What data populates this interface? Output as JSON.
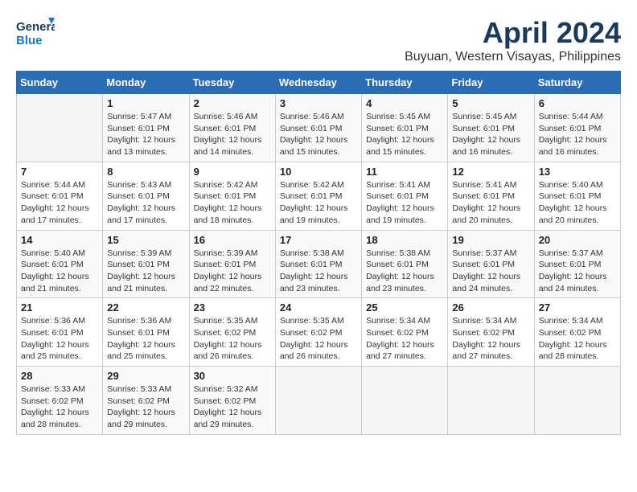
{
  "header": {
    "logo_general": "General",
    "logo_blue": "Blue",
    "month_title": "April 2024",
    "location": "Buyuan, Western Visayas, Philippines"
  },
  "weekdays": [
    "Sunday",
    "Monday",
    "Tuesday",
    "Wednesday",
    "Thursday",
    "Friday",
    "Saturday"
  ],
  "weeks": [
    [
      {
        "day": "",
        "info": ""
      },
      {
        "day": "1",
        "info": "Sunrise: 5:47 AM\nSunset: 6:01 PM\nDaylight: 12 hours\nand 13 minutes."
      },
      {
        "day": "2",
        "info": "Sunrise: 5:46 AM\nSunset: 6:01 PM\nDaylight: 12 hours\nand 14 minutes."
      },
      {
        "day": "3",
        "info": "Sunrise: 5:46 AM\nSunset: 6:01 PM\nDaylight: 12 hours\nand 15 minutes."
      },
      {
        "day": "4",
        "info": "Sunrise: 5:45 AM\nSunset: 6:01 PM\nDaylight: 12 hours\nand 15 minutes."
      },
      {
        "day": "5",
        "info": "Sunrise: 5:45 AM\nSunset: 6:01 PM\nDaylight: 12 hours\nand 16 minutes."
      },
      {
        "day": "6",
        "info": "Sunrise: 5:44 AM\nSunset: 6:01 PM\nDaylight: 12 hours\nand 16 minutes."
      }
    ],
    [
      {
        "day": "7",
        "info": "Sunrise: 5:44 AM\nSunset: 6:01 PM\nDaylight: 12 hours\nand 17 minutes."
      },
      {
        "day": "8",
        "info": "Sunrise: 5:43 AM\nSunset: 6:01 PM\nDaylight: 12 hours\nand 17 minutes."
      },
      {
        "day": "9",
        "info": "Sunrise: 5:42 AM\nSunset: 6:01 PM\nDaylight: 12 hours\nand 18 minutes."
      },
      {
        "day": "10",
        "info": "Sunrise: 5:42 AM\nSunset: 6:01 PM\nDaylight: 12 hours\nand 19 minutes."
      },
      {
        "day": "11",
        "info": "Sunrise: 5:41 AM\nSunset: 6:01 PM\nDaylight: 12 hours\nand 19 minutes."
      },
      {
        "day": "12",
        "info": "Sunrise: 5:41 AM\nSunset: 6:01 PM\nDaylight: 12 hours\nand 20 minutes."
      },
      {
        "day": "13",
        "info": "Sunrise: 5:40 AM\nSunset: 6:01 PM\nDaylight: 12 hours\nand 20 minutes."
      }
    ],
    [
      {
        "day": "14",
        "info": "Sunrise: 5:40 AM\nSunset: 6:01 PM\nDaylight: 12 hours\nand 21 minutes."
      },
      {
        "day": "15",
        "info": "Sunrise: 5:39 AM\nSunset: 6:01 PM\nDaylight: 12 hours\nand 21 minutes."
      },
      {
        "day": "16",
        "info": "Sunrise: 5:39 AM\nSunset: 6:01 PM\nDaylight: 12 hours\nand 22 minutes."
      },
      {
        "day": "17",
        "info": "Sunrise: 5:38 AM\nSunset: 6:01 PM\nDaylight: 12 hours\nand 23 minutes."
      },
      {
        "day": "18",
        "info": "Sunrise: 5:38 AM\nSunset: 6:01 PM\nDaylight: 12 hours\nand 23 minutes."
      },
      {
        "day": "19",
        "info": "Sunrise: 5:37 AM\nSunset: 6:01 PM\nDaylight: 12 hours\nand 24 minutes."
      },
      {
        "day": "20",
        "info": "Sunrise: 5:37 AM\nSunset: 6:01 PM\nDaylight: 12 hours\nand 24 minutes."
      }
    ],
    [
      {
        "day": "21",
        "info": "Sunrise: 5:36 AM\nSunset: 6:01 PM\nDaylight: 12 hours\nand 25 minutes."
      },
      {
        "day": "22",
        "info": "Sunrise: 5:36 AM\nSunset: 6:01 PM\nDaylight: 12 hours\nand 25 minutes."
      },
      {
        "day": "23",
        "info": "Sunrise: 5:35 AM\nSunset: 6:02 PM\nDaylight: 12 hours\nand 26 minutes."
      },
      {
        "day": "24",
        "info": "Sunrise: 5:35 AM\nSunset: 6:02 PM\nDaylight: 12 hours\nand 26 minutes."
      },
      {
        "day": "25",
        "info": "Sunrise: 5:34 AM\nSunset: 6:02 PM\nDaylight: 12 hours\nand 27 minutes."
      },
      {
        "day": "26",
        "info": "Sunrise: 5:34 AM\nSunset: 6:02 PM\nDaylight: 12 hours\nand 27 minutes."
      },
      {
        "day": "27",
        "info": "Sunrise: 5:34 AM\nSunset: 6:02 PM\nDaylight: 12 hours\nand 28 minutes."
      }
    ],
    [
      {
        "day": "28",
        "info": "Sunrise: 5:33 AM\nSunset: 6:02 PM\nDaylight: 12 hours\nand 28 minutes."
      },
      {
        "day": "29",
        "info": "Sunrise: 5:33 AM\nSunset: 6:02 PM\nDaylight: 12 hours\nand 29 minutes."
      },
      {
        "day": "30",
        "info": "Sunrise: 5:32 AM\nSunset: 6:02 PM\nDaylight: 12 hours\nand 29 minutes."
      },
      {
        "day": "",
        "info": ""
      },
      {
        "day": "",
        "info": ""
      },
      {
        "day": "",
        "info": ""
      },
      {
        "day": "",
        "info": ""
      }
    ]
  ]
}
